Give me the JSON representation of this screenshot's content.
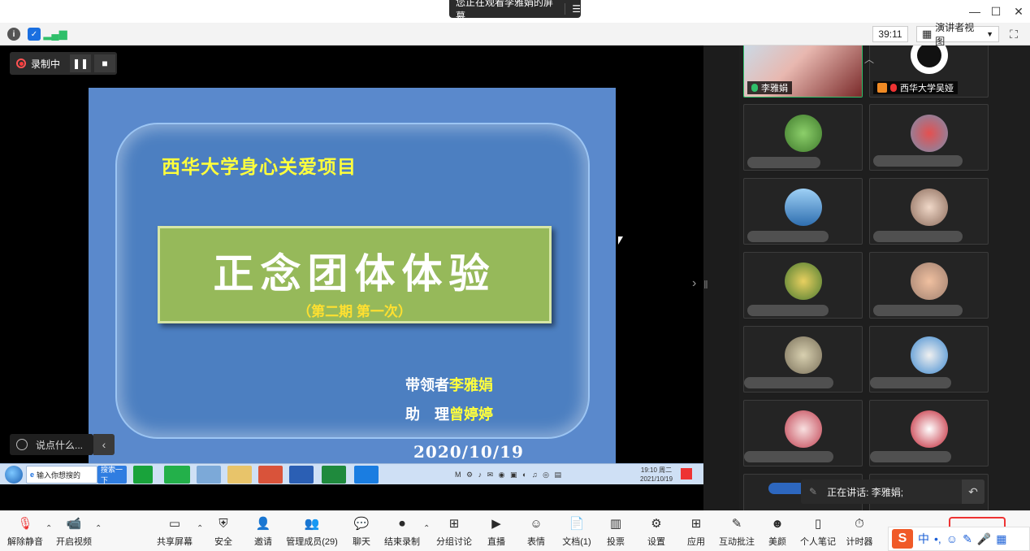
{
  "titlebar": {
    "share_notice": "您正在观看李雅娟的屏幕",
    "menu_icon": "list-icon",
    "controls": [
      "minimize-icon",
      "maximize-icon",
      "close-icon"
    ]
  },
  "infobar": {
    "timer": "39:11",
    "view_label": "演讲者视图",
    "icons": [
      "info-icon",
      "shield-icon",
      "signal-icon"
    ]
  },
  "recording": {
    "label": "录制中"
  },
  "slide": {
    "org": "西华大学身心关爱项目",
    "title": "正念团体体验",
    "subtitle": "（第二期 第一次）",
    "leader_label": "带领者",
    "leader_name": "李雅娟",
    "assistant_label": "助　理",
    "assistant_name": "曾婷婷",
    "date": "2020/10/19"
  },
  "taskbar": {
    "search_text": "输入你想搜的",
    "search_btn": "搜索一下",
    "clock_time": "19:10 周二",
    "clock_date": "2021/10/19"
  },
  "chat_input": {
    "placeholder": "说点什么..."
  },
  "participants": [
    {
      "name": "李雅娟",
      "active": true
    },
    {
      "name": "西华大学吴娅",
      "active": false
    }
  ],
  "speaking": {
    "label": "正在讲话: 李雅娟;"
  },
  "toolbar": {
    "items": [
      {
        "label": "解除静音",
        "icon": "mic-muted-icon"
      },
      {
        "label": "开启视频",
        "icon": "video-off-icon"
      },
      {
        "label": "共享屏幕",
        "icon": "share-screen-icon"
      },
      {
        "label": "安全",
        "icon": "shield-icon"
      },
      {
        "label": "邀请",
        "icon": "add-user-icon"
      },
      {
        "label": "管理成员(29)",
        "icon": "users-icon"
      },
      {
        "label": "聊天",
        "icon": "chat-icon"
      },
      {
        "label": "结束录制",
        "icon": "stop-record-icon"
      },
      {
        "label": "分组讨论",
        "icon": "breakout-icon"
      },
      {
        "label": "直播",
        "icon": "live-icon"
      },
      {
        "label": "表情",
        "icon": "emoji-icon"
      },
      {
        "label": "文档(1)",
        "icon": "document-icon"
      },
      {
        "label": "投票",
        "icon": "poll-icon"
      },
      {
        "label": "设置",
        "icon": "gear-icon"
      },
      {
        "label": "应用",
        "icon": "apps-icon"
      },
      {
        "label": "互动批注",
        "icon": "annotate-icon"
      },
      {
        "label": "美颜",
        "icon": "beauty-icon"
      },
      {
        "label": "个人笔记",
        "icon": "notes-icon"
      },
      {
        "label": "计时器",
        "icon": "timer-icon"
      }
    ]
  },
  "ime": {
    "mode": "中"
  },
  "colors": {
    "accent_green": "#2fbf6a",
    "record_red": "#ff3b3b",
    "slide_blue": "#5a89cc",
    "title_yellow": "#ffff3c"
  }
}
